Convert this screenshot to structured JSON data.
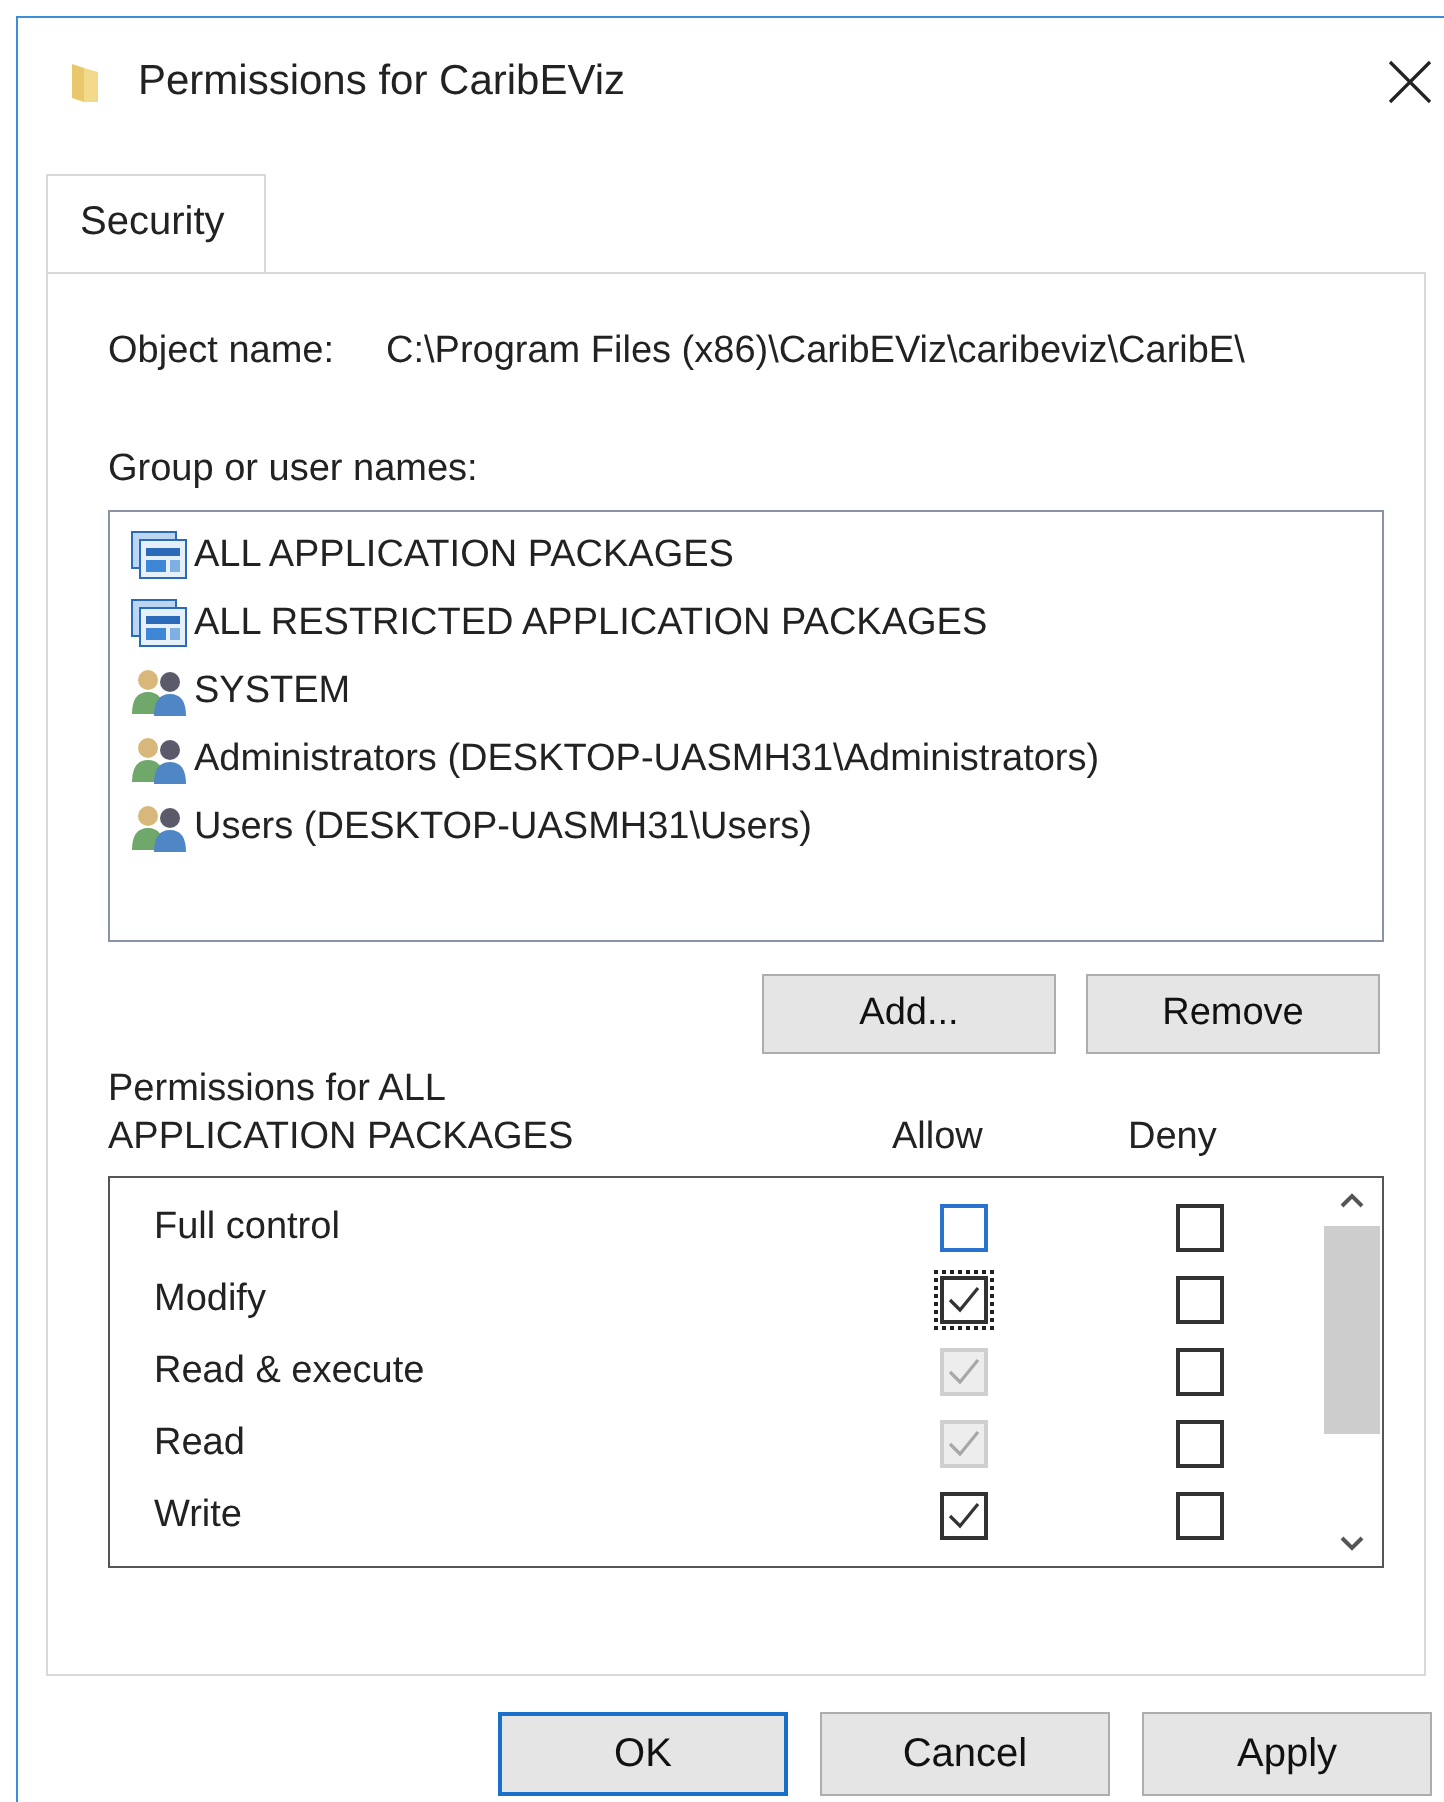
{
  "window": {
    "title": "Permissions for CaribEViz"
  },
  "tabs": [
    {
      "label": "Security",
      "selected": true
    }
  ],
  "object_name": {
    "label": "Object name:",
    "value": "C:\\Program Files (x86)\\CaribEViz\\caribeviz\\CaribE\\"
  },
  "group_label": "Group or user names:",
  "groups": [
    {
      "kind": "package",
      "name": "ALL APPLICATION PACKAGES"
    },
    {
      "kind": "package",
      "name": "ALL RESTRICTED APPLICATION PACKAGES"
    },
    {
      "kind": "users",
      "name": "SYSTEM"
    },
    {
      "kind": "users",
      "name": "Administrators (DESKTOP-UASMH31\\Administrators)"
    },
    {
      "kind": "users",
      "name": "Users (DESKTOP-UASMH31\\Users)"
    }
  ],
  "group_buttons": [
    "Add...",
    "Remove"
  ],
  "permissions": {
    "label_lines": [
      "Permissions for ALL",
      "APPLICATION PACKAGES"
    ],
    "columns": [
      "Allow",
      "Deny"
    ],
    "rows": [
      {
        "name": "Full control",
        "allow": {
          "checked": false,
          "disabled": false,
          "focused": false,
          "hovered": true
        },
        "deny": {
          "checked": false,
          "disabled": false
        }
      },
      {
        "name": "Modify",
        "allow": {
          "checked": true,
          "disabled": false,
          "focused": true,
          "hovered": false
        },
        "deny": {
          "checked": false,
          "disabled": false
        }
      },
      {
        "name": "Read & execute",
        "allow": {
          "checked": true,
          "disabled": true,
          "focused": false,
          "hovered": false
        },
        "deny": {
          "checked": false,
          "disabled": false
        }
      },
      {
        "name": "Read",
        "allow": {
          "checked": true,
          "disabled": true,
          "focused": false,
          "hovered": false
        },
        "deny": {
          "checked": false,
          "disabled": false
        }
      },
      {
        "name": "Write",
        "allow": {
          "checked": true,
          "disabled": false,
          "focused": false,
          "hovered": false
        },
        "deny": {
          "checked": false,
          "disabled": false
        }
      }
    ]
  },
  "buttons": [
    {
      "label": "OK",
      "default": true
    },
    {
      "label": "Cancel",
      "default": false
    },
    {
      "label": "Apply",
      "default": false
    }
  ]
}
